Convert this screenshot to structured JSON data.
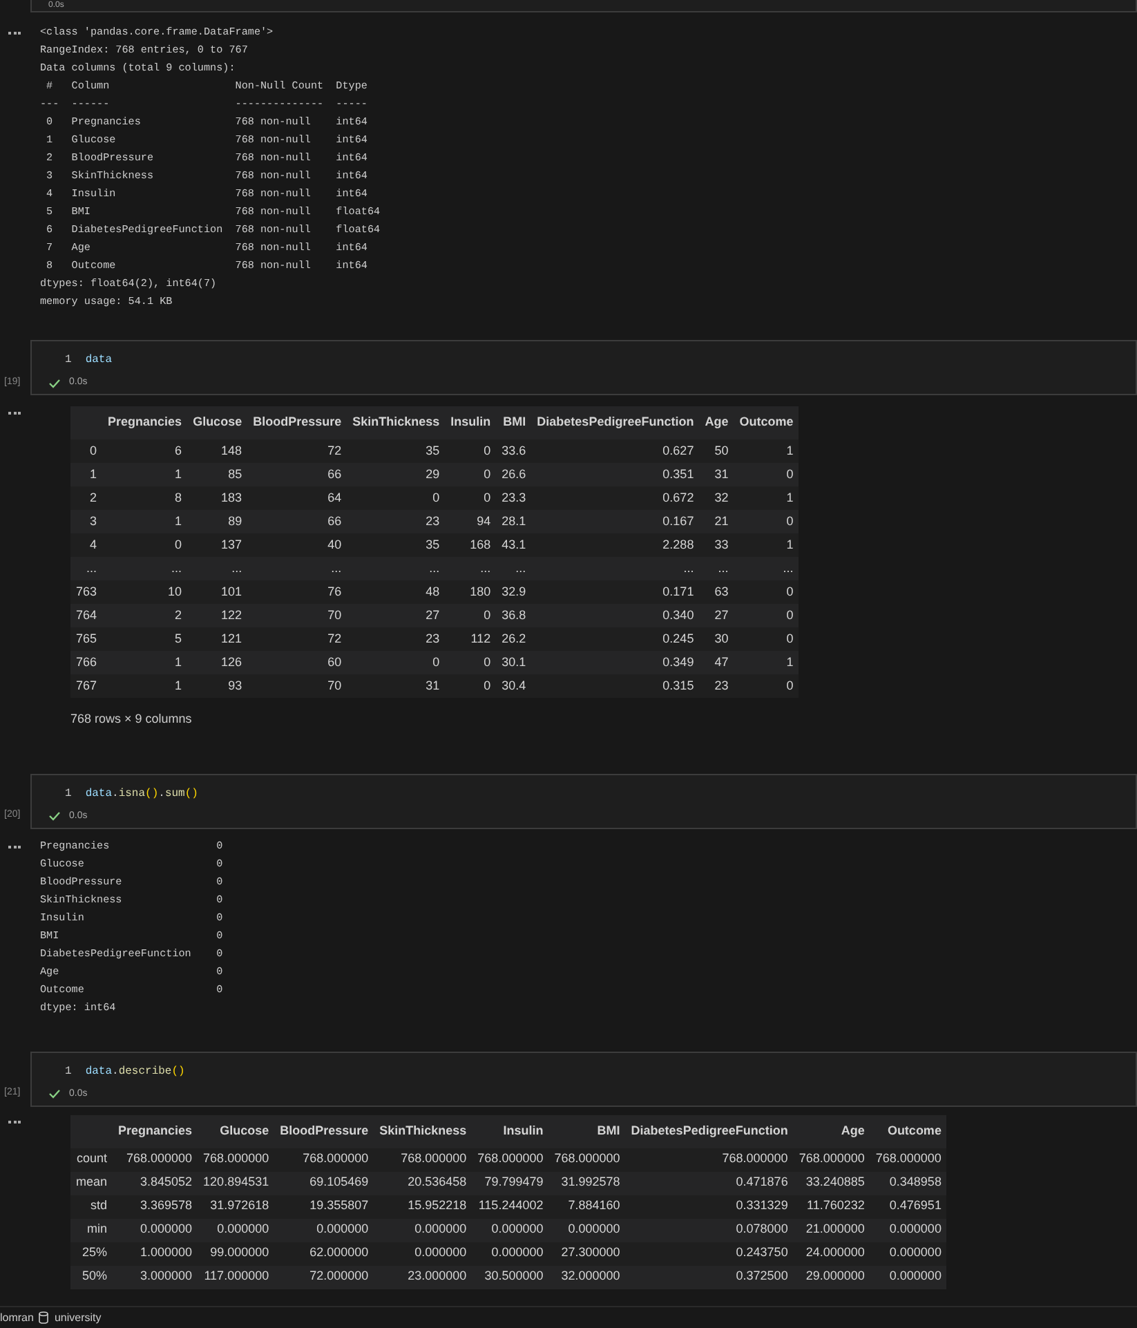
{
  "top_cell": {
    "status": "0.0s"
  },
  "info_output": {
    "lines": [
      "<class 'pandas.core.frame.DataFrame'>",
      "RangeIndex: 768 entries, 0 to 767",
      "Data columns (total 9 columns):",
      " #   Column                    Non-Null Count  Dtype  ",
      "---  ------                    --------------  -----  ",
      " 0   Pregnancies               768 non-null    int64  ",
      " 1   Glucose                   768 non-null    int64  ",
      " 2   BloodPressure             768 non-null    int64  ",
      " 3   SkinThickness             768 non-null    int64  ",
      " 4   Insulin                   768 non-null    int64  ",
      " 5   BMI                       768 non-null    float64",
      " 6   DiabetesPedigreeFunction  768 non-null    float64",
      " 7   Age                       768 non-null    int64  ",
      " 8   Outcome                   768 non-null    int64  ",
      "dtypes: float64(2), int64(7)",
      "memory usage: 54.1 KB"
    ]
  },
  "cells": [
    {
      "execution_count": "[19]",
      "line_number": "1",
      "code": [
        {
          "kind": "variable",
          "text": "data"
        }
      ],
      "status": "0.0s",
      "output": {
        "kind": "table",
        "columns": [
          "",
          "Pregnancies",
          "Glucose",
          "BloodPressure",
          "SkinThickness",
          "Insulin",
          "BMI",
          "DiabetesPedigreeFunction",
          "Age",
          "Outcome"
        ],
        "rows": [
          [
            "0",
            "6",
            "148",
            "72",
            "35",
            "0",
            "33.6",
            "0.627",
            "50",
            "1"
          ],
          [
            "1",
            "1",
            "85",
            "66",
            "29",
            "0",
            "26.6",
            "0.351",
            "31",
            "0"
          ],
          [
            "2",
            "8",
            "183",
            "64",
            "0",
            "0",
            "23.3",
            "0.672",
            "32",
            "1"
          ],
          [
            "3",
            "1",
            "89",
            "66",
            "23",
            "94",
            "28.1",
            "0.167",
            "21",
            "0"
          ],
          [
            "4",
            "0",
            "137",
            "40",
            "35",
            "168",
            "43.1",
            "2.288",
            "33",
            "1"
          ],
          [
            "...",
            "...",
            "...",
            "...",
            "...",
            "...",
            "...",
            "...",
            "...",
            "..."
          ],
          [
            "763",
            "10",
            "101",
            "76",
            "48",
            "180",
            "32.9",
            "0.171",
            "63",
            "0"
          ],
          [
            "764",
            "2",
            "122",
            "70",
            "27",
            "0",
            "36.8",
            "0.340",
            "27",
            "0"
          ],
          [
            "765",
            "5",
            "121",
            "72",
            "23",
            "112",
            "26.2",
            "0.245",
            "30",
            "0"
          ],
          [
            "766",
            "1",
            "126",
            "60",
            "0",
            "0",
            "30.1",
            "0.349",
            "47",
            "1"
          ],
          [
            "767",
            "1",
            "93",
            "70",
            "31",
            "0",
            "30.4",
            "0.315",
            "23",
            "0"
          ]
        ],
        "caption": "768 rows × 9 columns"
      }
    },
    {
      "execution_count": "[20]",
      "line_number": "1",
      "code": [
        {
          "kind": "variable",
          "text": "data"
        },
        {
          "kind": "plain",
          "text": "."
        },
        {
          "kind": "function",
          "text": "isna"
        },
        {
          "kind": "bracket",
          "text": "()"
        },
        {
          "kind": "plain",
          "text": "."
        },
        {
          "kind": "function",
          "text": "sum"
        },
        {
          "kind": "bracket",
          "text": "()"
        }
      ],
      "status": "0.0s",
      "output": {
        "kind": "text",
        "lines": [
          "Pregnancies                 0",
          "Glucose                     0",
          "BloodPressure               0",
          "SkinThickness               0",
          "Insulin                     0",
          "BMI                         0",
          "DiabetesPedigreeFunction    0",
          "Age                         0",
          "Outcome                     0",
          "dtype: int64"
        ]
      }
    },
    {
      "execution_count": "[21]",
      "line_number": "1",
      "code": [
        {
          "kind": "variable",
          "text": "data"
        },
        {
          "kind": "plain",
          "text": "."
        },
        {
          "kind": "function",
          "text": "describe"
        },
        {
          "kind": "bracket",
          "text": "()"
        }
      ],
      "status": "0.0s",
      "output": {
        "kind": "table",
        "columns": [
          "",
          "Pregnancies",
          "Glucose",
          "BloodPressure",
          "SkinThickness",
          "Insulin",
          "BMI",
          "DiabetesPedigreeFunction",
          "Age",
          "Outcome"
        ],
        "rows": [
          [
            "count",
            "768.000000",
            "768.000000",
            "768.000000",
            "768.000000",
            "768.000000",
            "768.000000",
            "768.000000",
            "768.000000",
            "768.000000"
          ],
          [
            "mean",
            "3.845052",
            "120.894531",
            "69.105469",
            "20.536458",
            "79.799479",
            "31.992578",
            "0.471876",
            "33.240885",
            "0.348958"
          ],
          [
            "std",
            "3.369578",
            "31.972618",
            "19.355807",
            "15.952218",
            "115.244002",
            "7.884160",
            "0.331329",
            "11.760232",
            "0.476951"
          ],
          [
            "min",
            "0.000000",
            "0.000000",
            "0.000000",
            "0.000000",
            "0.000000",
            "0.000000",
            "0.078000",
            "21.000000",
            "0.000000"
          ],
          [
            "25%",
            "1.000000",
            "99.000000",
            "62.000000",
            "0.000000",
            "0.000000",
            "27.300000",
            "0.243750",
            "24.000000",
            "0.000000"
          ],
          [
            "50%",
            "3.000000",
            "117.000000",
            "72.000000",
            "23.000000",
            "30.500000",
            "32.000000",
            "0.372500",
            "29.000000",
            "0.000000"
          ]
        ]
      }
    }
  ],
  "status_bar": {
    "user": "lomran",
    "database": "university"
  }
}
